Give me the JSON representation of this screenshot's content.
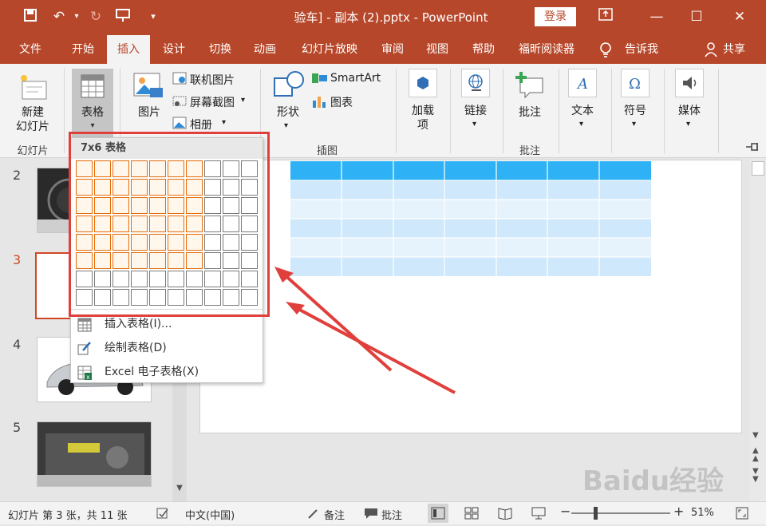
{
  "app": {
    "title": "验车] - 副本 (2).pptx  -  PowerPoint",
    "login": "登录"
  },
  "tabs": [
    "文件",
    "开始",
    "插入",
    "设计",
    "切换",
    "动画",
    "幻灯片放映",
    "审阅",
    "视图",
    "帮助",
    "福昕阅读器",
    "告诉我",
    "共享"
  ],
  "ribbon": {
    "new_slide": "新建\n幻灯片",
    "table": "表格",
    "picture": "图片",
    "online_picture": "联机图片",
    "screenshot": "屏幕截图",
    "album": "相册",
    "shapes": "形状",
    "smartart": "SmartArt",
    "chart": "图表",
    "addins": "加载\n项",
    "link": "链接",
    "comment": "批注",
    "text": "文本",
    "symbol": "符号",
    "media": "媒体",
    "groups": {
      "slides": "幻灯片",
      "illustrations": "插图",
      "comments": "批注"
    }
  },
  "dropdown": {
    "header": "7x6 表格",
    "grid_cols": 10,
    "grid_rows": 8,
    "selected_cols": 7,
    "selected_rows": 6,
    "items": [
      {
        "label": "插入表格(I)...",
        "icon": "table-icon"
      },
      {
        "label": "绘制表格(D)",
        "icon": "draw-table-icon"
      },
      {
        "label": "Excel 电子表格(X)",
        "icon": "excel-icon"
      }
    ]
  },
  "slides": [
    {
      "num": "2"
    },
    {
      "num": "3"
    },
    {
      "num": "4"
    },
    {
      "num": "5"
    }
  ],
  "status": {
    "slide_info": "幻灯片 第 3 张，共 11 张",
    "language": "中文(中国)",
    "notes": "备注",
    "comments": "批注",
    "zoom": "51%"
  },
  "watermark": "Baidu经验",
  "colors": {
    "accent": "#b7472a",
    "highlight": "#e46c0a",
    "annotation": "#e0403c",
    "table_header": "#2eb2f5",
    "table_band1": "#cfe8fb",
    "table_band2": "#e6f3fd"
  }
}
